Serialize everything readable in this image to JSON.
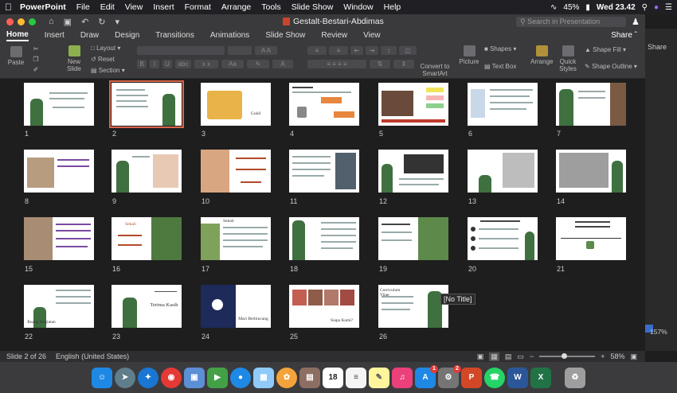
{
  "menubar": {
    "apple": "",
    "items": [
      "PowerPoint",
      "File",
      "Edit",
      "View",
      "Insert",
      "Format",
      "Arrange",
      "Tools",
      "Slide Show",
      "Window",
      "Help"
    ],
    "battery": "45%",
    "clock": "Wed 23.42"
  },
  "window": {
    "title": "Gestalt-Bestari-Abdimas",
    "search_placeholder": "Search in Presentation"
  },
  "tabs": [
    "Home",
    "Insert",
    "Draw",
    "Design",
    "Transitions",
    "Animations",
    "Slide Show",
    "Review",
    "View"
  ],
  "share_label": "Share",
  "ribbon": {
    "paste": "Paste",
    "new_slide": "New Slide",
    "layout": "Layout",
    "reset": "Reset",
    "section": "Section",
    "convert": "Convert to SmartArt",
    "picture": "Picture",
    "shapes": "Shapes",
    "text_box": "Text Box",
    "arrange": "Arrange",
    "quick_styles": "Quick Styles",
    "shape_fill": "Shape Fill",
    "shape_outline": "Shape Outline"
  },
  "side_panel": {
    "share": "Share",
    "zoom": "157%"
  },
  "slides": [
    {
      "n": "1",
      "theme": "plant-text"
    },
    {
      "n": "2",
      "theme": "text-plant"
    },
    {
      "n": "3",
      "theme": "kids-photo"
    },
    {
      "n": "4",
      "theme": "diagram"
    },
    {
      "n": "5",
      "theme": "photo-boxes"
    },
    {
      "n": "6",
      "theme": "text-cols"
    },
    {
      "n": "7",
      "theme": "text-plant"
    },
    {
      "n": "8",
      "theme": "photo-text"
    },
    {
      "n": "9",
      "theme": "photo-kids"
    },
    {
      "n": "10",
      "theme": "title-photo"
    },
    {
      "n": "11",
      "theme": "text-bars"
    },
    {
      "n": "12",
      "theme": "plant-photo"
    },
    {
      "n": "13",
      "theme": "plant-bw"
    },
    {
      "n": "14",
      "theme": "bw-sketch"
    },
    {
      "n": "15",
      "theme": "photo-text"
    },
    {
      "n": "16",
      "theme": "title-plant"
    },
    {
      "n": "17",
      "theme": "field-text"
    },
    {
      "n": "18",
      "theme": "plant-list"
    },
    {
      "n": "19",
      "theme": "text-plant"
    },
    {
      "n": "20",
      "theme": "list-plant"
    },
    {
      "n": "21",
      "theme": "timeline"
    },
    {
      "n": "22",
      "theme": "plant-title"
    },
    {
      "n": "23",
      "theme": "plant-title"
    },
    {
      "n": "24",
      "theme": "navy-logo"
    },
    {
      "n": "25",
      "theme": "photo-strip"
    },
    {
      "n": "26",
      "theme": "text-plant"
    }
  ],
  "slide_texts": {
    "s3": "Gokil",
    "s16": "Sekali",
    "s17": "Sekali",
    "s22": "Ruang Kegiatan",
    "s23": "Terima Kasih",
    "s24": "Mari Berbincang",
    "s25": "Siapa Kami?",
    "s26": "Curriculum Vitae"
  },
  "selected_slide": "2",
  "tooltip": "[No Title]",
  "status": {
    "slide_indicator": "Slide 2 of 26",
    "language": "English (United States)",
    "zoom": "58%"
  },
  "dock": [
    {
      "name": "finder",
      "color": "#1e88e5",
      "label": ""
    },
    {
      "name": "launchpad",
      "color": "#607d8b",
      "label": ""
    },
    {
      "name": "safari",
      "color": "#1976d2",
      "label": ""
    },
    {
      "name": "chrome",
      "color": "#e53935",
      "label": ""
    },
    {
      "name": "preview",
      "color": "#5c8fd6",
      "label": ""
    },
    {
      "name": "facetime",
      "color": "#43a047",
      "label": ""
    },
    {
      "name": "messages",
      "color": "#1e88e5",
      "label": ""
    },
    {
      "name": "finder-2",
      "color": "#90caf9",
      "label": ""
    },
    {
      "name": "photos",
      "color": "#f4a33a",
      "label": ""
    },
    {
      "name": "notes-book",
      "color": "#8d6e63",
      "label": ""
    },
    {
      "name": "calendar",
      "color": "#ffffff",
      "label": "18"
    },
    {
      "name": "reminders",
      "color": "#f5f5f5",
      "label": ""
    },
    {
      "name": "notes",
      "color": "#fff59d",
      "label": ""
    },
    {
      "name": "music",
      "color": "#ec407a",
      "label": ""
    },
    {
      "name": "app-store",
      "color": "#1e88e5",
      "label": "",
      "badge": "1"
    },
    {
      "name": "system-preferences",
      "color": "#757575",
      "label": "",
      "badge": "2"
    },
    {
      "name": "powerpoint",
      "color": "#d24726",
      "label": "P"
    },
    {
      "name": "whatsapp",
      "color": "#25d366",
      "label": ""
    },
    {
      "name": "word",
      "color": "#2b579a",
      "label": "W"
    },
    {
      "name": "excel",
      "color": "#217346",
      "label": "X"
    },
    {
      "name": "trash",
      "color": "#9e9e9e",
      "label": ""
    }
  ],
  "colors": {
    "selected_outline": "#d9654b",
    "accent": "#c9452a"
  }
}
